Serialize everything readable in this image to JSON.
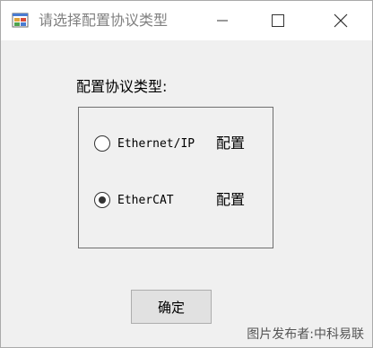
{
  "window": {
    "title": "请选择配置协议类型",
    "icon": "app-form-icon",
    "controls": [
      "minimize-icon",
      "maximize-icon",
      "close-icon"
    ]
  },
  "dialog": {
    "group_label": "配置协议类型:",
    "options": [
      {
        "label": "Ethernet/IP",
        "config_label": "配置",
        "checked": false
      },
      {
        "label": "EtherCAT",
        "config_label": "配置",
        "checked": true
      }
    ],
    "ok_label": "确定"
  },
  "watermark": "图片发布者:中科易联"
}
